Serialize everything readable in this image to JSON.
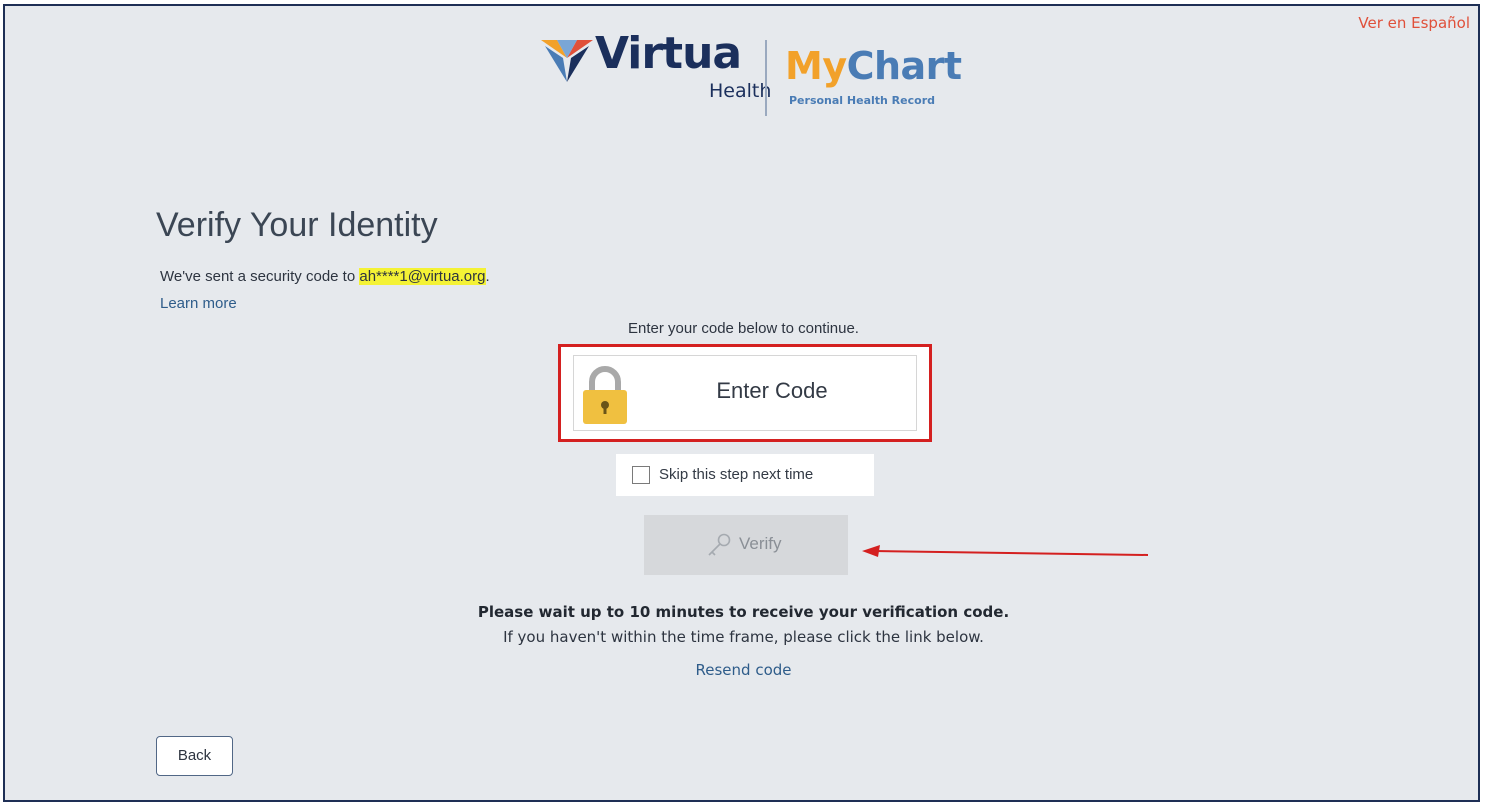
{
  "header": {
    "language_link": "Ver en Español",
    "logo": {
      "brand": "Virtua",
      "sub": "Health",
      "product_my": "My",
      "product_chart": "Chart",
      "tagline": "Personal Health Record"
    }
  },
  "main": {
    "title": "Verify Your Identity",
    "sent_prefix": "We've sent a security code to ",
    "email": "ah****1@virtua.org",
    "sent_suffix": ".",
    "learn_more": "Learn more",
    "instructions": "Enter your code below to continue.",
    "code_input": {
      "placeholder": "Enter Code",
      "value": ""
    },
    "skip_label": "Skip this step next time",
    "skip_checked": false,
    "verify_label": "Verify",
    "wait_bold": "Please wait up to 10 minutes to receive your verification code.",
    "wait_sub": "If you haven't within the time frame, please click the link below.",
    "resend": "Resend code"
  },
  "footer": {
    "back_label": "Back"
  },
  "icons": {
    "lock": "lock-icon",
    "key": "key-icon",
    "logo_mark": "virtua-v-icon",
    "arrow": "red-arrow-annotation"
  },
  "colors": {
    "highlight": "#f4f235",
    "annotation_red": "#d42020",
    "link": "#2e5c8a",
    "lang_link": "#e0503a",
    "lock_gold": "#f0c040",
    "brand_navy": "#1b2f5c",
    "mychart_orange": "#f2a12a",
    "mychart_blue": "#4a7cb5"
  }
}
